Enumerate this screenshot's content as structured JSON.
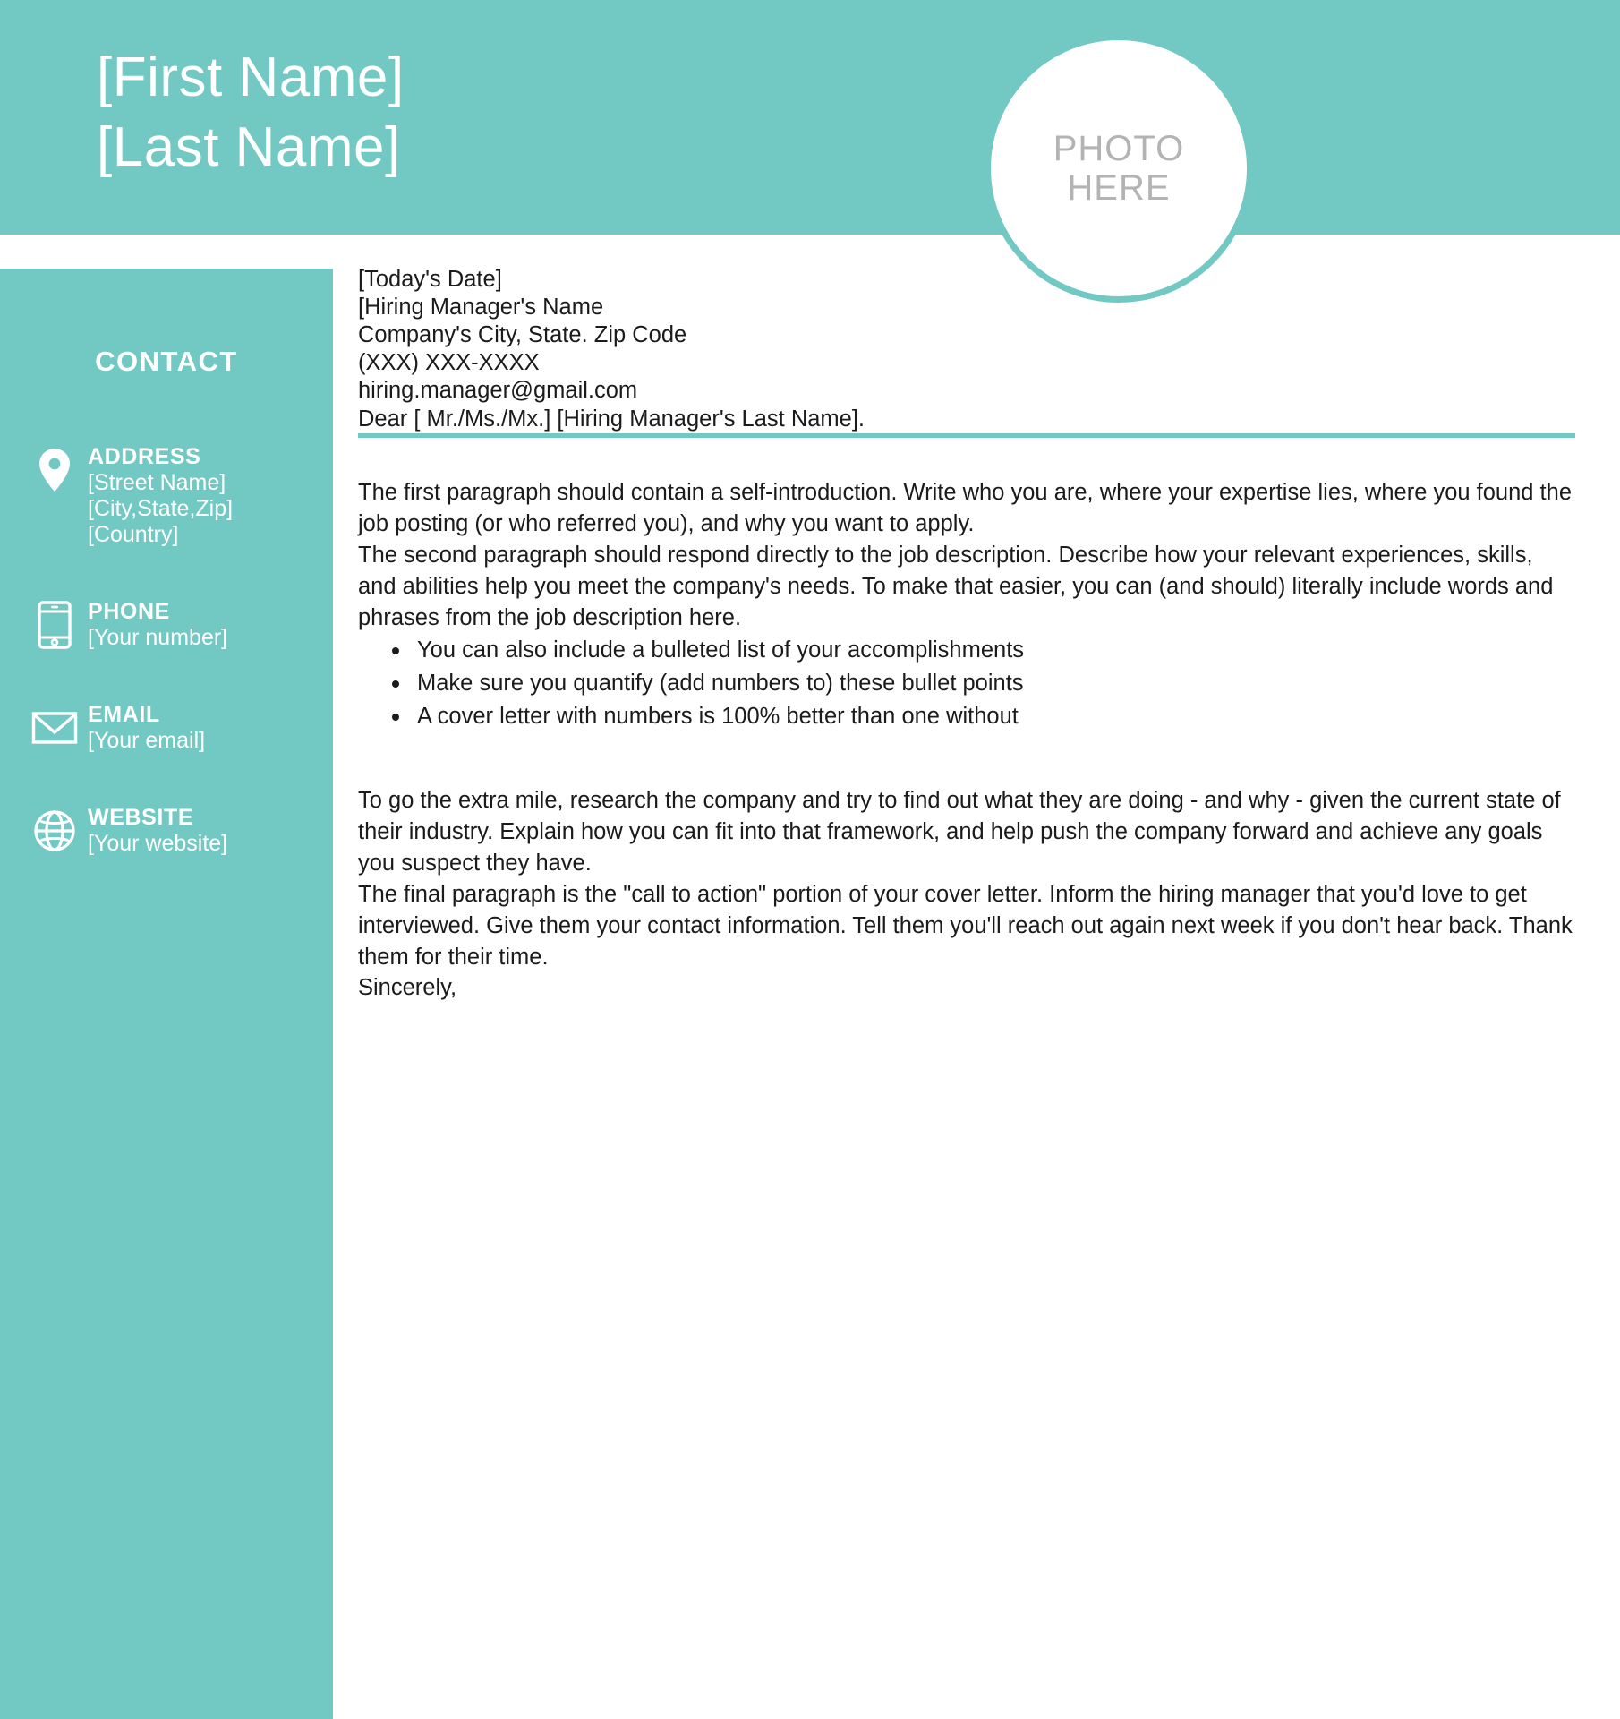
{
  "theme": {
    "accent": "#72c9c3",
    "text": "#1b1b1b",
    "photo_text": "#b3b3b3",
    "on_accent": "#ffffff"
  },
  "header": {
    "first_name": "[First Name]",
    "last_name": "[Last Name]",
    "photo_placeholder_line1": "PHOTO",
    "photo_placeholder_line2": "HERE"
  },
  "sidebar": {
    "title": "CONTACT",
    "items": [
      {
        "icon": "location-pin-icon",
        "label": "ADDRESS",
        "value_lines": [
          "[Street Name]",
          "[City,State,Zip]",
          "[Country]"
        ]
      },
      {
        "icon": "smartphone-icon",
        "label": "PHONE",
        "value_lines": [
          "[Your number]"
        ]
      },
      {
        "icon": "envelope-icon",
        "label": "EMAIL",
        "value_lines": [
          "[Your email]"
        ]
      },
      {
        "icon": "globe-icon",
        "label": "WEBSITE",
        "value_lines": [
          "[Your website]"
        ]
      }
    ]
  },
  "letter": {
    "date": "[Today's Date]",
    "recipient_lines": [
      "[Hiring Manager's Name",
      "Company's City, State. Zip Code",
      "(XXX) XXX-XXXX",
      "hiring.manager@gmail.com"
    ],
    "salutation": "Dear [ Mr./Ms./Mx.] [Hiring Manager's Last Name].",
    "paragraph_1": "The first paragraph should contain a self-introduction. Write who you are, where your expertise lies, where you found the job posting (or who referred you), and why you want to apply.",
    "paragraph_2": "The second paragraph should respond directly to the job description. Describe how your relevant experiences, skills, and abilities help you meet the company's needs. To make that easier, you can (and should) literally include words and phrases from the job description here.",
    "bullets": [
      "You can also include a bulleted list of your accomplishments",
      "Make sure you quantify (add numbers to) these bullet points",
      "A cover letter with numbers is 100% better than one without"
    ],
    "paragraph_3": "To go the extra mile, research the company and try to find out what they are doing - and why - given the current state of their industry. Explain how you can fit into that framework, and help push the company forward and achieve any goals you suspect they have.",
    "paragraph_4": "The final paragraph is the \"call to action\" portion of your cover letter. Inform the hiring manager that you'd love to get interviewed. Give them your contact information. Tell them you'll reach out again next week if you don't hear back. Thank them for their time.",
    "closing": "Sincerely,"
  }
}
